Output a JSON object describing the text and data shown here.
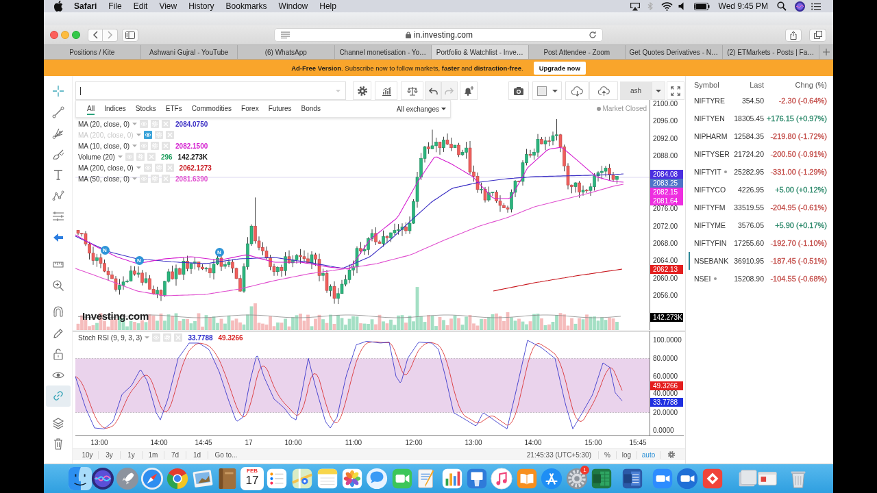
{
  "menu_bar": {
    "app_name": "Safari",
    "menus": [
      "File",
      "Edit",
      "View",
      "History",
      "Bookmarks",
      "Window",
      "Help"
    ],
    "clock": "Wed 9:45 PM"
  },
  "browser": {
    "address": "in.investing.com",
    "tabs": [
      {
        "label": "Positions / Kite",
        "selected": false
      },
      {
        "label": "Ashwani Gujral - YouTube",
        "selected": false
      },
      {
        "label": "(6) WhatsApp",
        "selected": false
      },
      {
        "label": "Channel monetisation - Yo…",
        "selected": false
      },
      {
        "label": "Portfolio & Watchlist - Inve…",
        "selected": true
      },
      {
        "label": "Post Attendee - Zoom",
        "selected": false
      },
      {
        "label": "Get Quotes Derivatives - N…",
        "selected": false
      },
      {
        "label": "(2) ETMarkets - Posts | Fa…",
        "selected": false
      }
    ]
  },
  "banner": {
    "text": "**Ad-Free Version**. Subscribe now to follow markets, **faster** and **distraction-free**.",
    "button": "Upgrade now"
  },
  "drawing_tools": [
    {
      "selected": false
    },
    {
      "selected": false
    },
    {
      "selected": false
    },
    {
      "selected": false
    },
    {
      "selected": false
    },
    {
      "selected": false
    },
    {
      "selected": false
    },
    {
      "selected": false
    },
    {
      "selected": false
    },
    {
      "selected": false
    },
    {
      "selected": false
    },
    {
      "selected": false
    },
    {
      "selected": false
    },
    {
      "selected": false
    },
    {
      "selected": true
    },
    {
      "selected": false
    },
    {
      "selected": false
    }
  ],
  "chart": {
    "toolbar": {
      "layout_name": "ash"
    },
    "search_filters": [
      {
        "label": "All",
        "selected": true
      },
      {
        "label": "Indices",
        "selected": false
      },
      {
        "label": "Stocks",
        "selected": false
      },
      {
        "label": "ETFs",
        "selected": false
      },
      {
        "label": "Commodities",
        "selected": false
      },
      {
        "label": "Forex",
        "selected": false
      },
      {
        "label": "Futures",
        "selected": false
      },
      {
        "label": "Bonds",
        "selected": false
      }
    ],
    "exchange_filter": "All exchanges",
    "market_status": "Market Closed",
    "legend": [
      {
        "label": "MA (20, close, 0)",
        "hidden": false,
        "values": [
          {
            "text": "2084.0750",
            "color": "#3b2fc4"
          }
        ]
      },
      {
        "label": "MA (200, close, 0)",
        "hidden": true
      },
      {
        "label": "MA (10, close, 0)",
        "hidden": false,
        "values": [
          {
            "text": "2082.1500",
            "color": "#d41ccf"
          }
        ]
      },
      {
        "label": "Volume (20)",
        "hidden": false,
        "values": [
          {
            "text": "296",
            "color": "#1f9e5e"
          },
          {
            "text": "142.273K",
            "color": "#111111"
          }
        ]
      },
      {
        "label": "MA (200, close, 0)",
        "hidden": false,
        "values": [
          {
            "text": "2062.1273",
            "color": "#c8161d"
          }
        ]
      },
      {
        "label": "MA (50, close, 0)",
        "hidden": false,
        "values": [
          {
            "text": "2081.6390",
            "color": "#e04fcf"
          }
        ]
      }
    ],
    "news_markers": [
      "N",
      "N",
      "N"
    ],
    "chart_logo": "Investing.com",
    "price_axis": [
      {
        "kind": "tick",
        "text": "2100.00"
      },
      {
        "kind": "tick",
        "text": "2096.00"
      },
      {
        "kind": "tick",
        "text": "2092.00"
      },
      {
        "kind": "tick",
        "text": "2088.00"
      },
      {
        "kind": "tag",
        "text": "2084.08",
        "color": "#4b2fe0"
      },
      {
        "kind": "tag",
        "text": "2083.25",
        "color": "#4f74c9"
      },
      {
        "kind": "tag",
        "text": "2082.15",
        "color": "#ee2ee0"
      },
      {
        "kind": "tag",
        "text": "2081.64",
        "color": "#ee2ee0"
      },
      {
        "kind": "tick",
        "text": "2076.00"
      },
      {
        "kind": "tick",
        "text": "2072.00"
      },
      {
        "kind": "tick",
        "text": "2068.00"
      },
      {
        "kind": "tick",
        "text": "2064.00"
      },
      {
        "kind": "tag",
        "text": "2062.13",
        "color": "#e41e1e"
      },
      {
        "kind": "tick",
        "text": "2060.00"
      },
      {
        "kind": "tick",
        "text": "2056.00"
      },
      {
        "kind": "tag",
        "text": "142.273K",
        "color": "#000000"
      }
    ],
    "stoch": {
      "label": "Stoch RSI (9, 9, 3, 3)",
      "values": [
        {
          "text": "33.7788",
          "color": "#2323c8"
        },
        {
          "text": "49.3266",
          "color": "#d81e1e"
        }
      ],
      "axis": [
        {
          "kind": "tick",
          "text": "100.0000"
        },
        {
          "kind": "tick",
          "text": "80.0000"
        },
        {
          "kind": "tick",
          "text": "60.0000"
        },
        {
          "kind": "tag",
          "text": "49.3266",
          "color": "#e41e1e"
        },
        {
          "kind": "tick",
          "text": "40.0000"
        },
        {
          "kind": "tag",
          "text": "33.7788",
          "color": "#1f2fe0"
        },
        {
          "kind": "tick",
          "text": "20.0000"
        },
        {
          "kind": "tick",
          "text": "0.0000"
        }
      ]
    },
    "time_axis": [
      "13:00",
      "14:00",
      "14:45",
      "17",
      "10:00",
      "11:00",
      "12:00",
      "13:00",
      "14:00",
      "15:00",
      "15:45"
    ],
    "bottom_bar": {
      "ranges": [
        "10y",
        "3y",
        "1y",
        "1m",
        "7d",
        "1d"
      ],
      "goto": "Go to...",
      "clock": "21:45:33 (UTC+5:30)",
      "scales": [
        {
          "label": "%",
          "selected": false
        },
        {
          "label": "log",
          "selected": false
        },
        {
          "label": "auto",
          "selected": true
        }
      ]
    }
  },
  "watchlist": {
    "columns": [
      "Symbol",
      "Last",
      "Chng (%)"
    ],
    "rows": [
      {
        "symbol": "NIFTYRE",
        "dot": false,
        "last": "354.50",
        "change": "-2.30 (-0.64%)",
        "color": "#c4504c",
        "selected": false
      },
      {
        "symbol": "NIFTYEN",
        "dot": false,
        "last": "18305.45",
        "change": "+176.15 (+0.97%)",
        "color": "#2e8a6c",
        "selected": false
      },
      {
        "symbol": "NIPHARM",
        "dot": false,
        "last": "12584.35",
        "change": "-219.80 (-1.72%)",
        "color": "#c4504c",
        "selected": false
      },
      {
        "symbol": "NIFTYSER",
        "dot": false,
        "last": "21724.20",
        "change": "-200.50 (-0.91%)",
        "color": "#c4504c",
        "selected": false
      },
      {
        "symbol": "NIFTYIT",
        "dot": true,
        "last": "25282.95",
        "change": "-331.00 (-1.29%)",
        "color": "#c4504c",
        "selected": false
      },
      {
        "symbol": "NIFTYCO",
        "dot": false,
        "last": "4226.95",
        "change": "+5.00 (+0.12%)",
        "color": "#2e8a6c",
        "selected": false
      },
      {
        "symbol": "NIFTYFM",
        "dot": false,
        "last": "33519.55",
        "change": "-204.95 (-0.61%)",
        "color": "#c4504c",
        "selected": false
      },
      {
        "symbol": "NIFTYME",
        "dot": false,
        "last": "3576.05",
        "change": "+5.90 (+0.17%)",
        "color": "#2e8a6c",
        "selected": false
      },
      {
        "symbol": "NIFTYFIN",
        "dot": false,
        "last": "17255.60",
        "change": "-192.70 (-1.10%)",
        "color": "#c4504c",
        "selected": false
      },
      {
        "symbol": "NSEBANK",
        "dot": false,
        "last": "36910.95",
        "change": "-187.45 (-0.51%)",
        "color": "#c4504c",
        "selected": true
      },
      {
        "symbol": "NSEI",
        "dot": true,
        "last": "15208.90",
        "change": "-104.55 (-0.68%)",
        "color": "#c4504c",
        "selected": false
      }
    ]
  },
  "dock": {
    "calendar_month": "FEB",
    "calendar_day": "17",
    "badge": "1"
  }
}
